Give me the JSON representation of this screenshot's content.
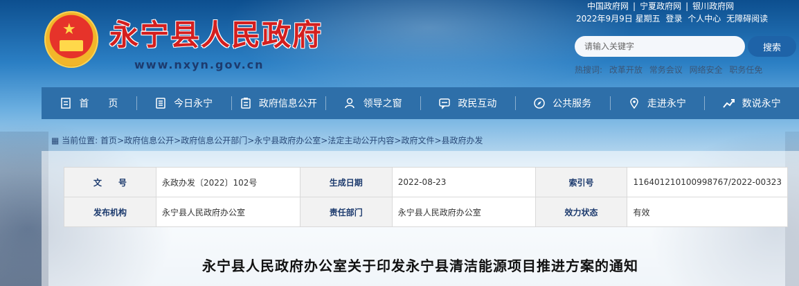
{
  "header": {
    "site_title": "永宁县人民政府",
    "site_url": "www.nxyn.gov.cn",
    "top_links": [
      "中国政府网",
      "宁夏政府网",
      "银川政府网"
    ],
    "date": "2022年9月9日 星期五",
    "quick_links": [
      "登录",
      "个人中心",
      "无障碍阅读"
    ]
  },
  "search": {
    "placeholder": "请输入关键字",
    "button": "搜索",
    "hot_label": "热搜词:",
    "hot_words": [
      "改革开放",
      "常务会议",
      "网络安全",
      "职务任免"
    ]
  },
  "nav": {
    "items": [
      {
        "label": "首　　页",
        "icon": "home-icon"
      },
      {
        "label": "今日永宁",
        "icon": "list-icon"
      },
      {
        "label": "政府信息公开",
        "icon": "document-icon"
      },
      {
        "label": "领导之窗",
        "icon": "user-icon"
      },
      {
        "label": "政民互动",
        "icon": "chat-icon"
      },
      {
        "label": "公共服务",
        "icon": "compass-icon"
      },
      {
        "label": "走进永宁",
        "icon": "location-icon"
      },
      {
        "label": "数说永宁",
        "icon": "trend-icon"
      }
    ]
  },
  "breadcrumb": {
    "label": "当前位置:",
    "items": [
      "首页",
      "政府信息公开",
      "政府信息公开部门",
      "永宁县政府办公室",
      "法定主动公开内容",
      "政府文件",
      "县政府办发"
    ]
  },
  "meta": {
    "rows": [
      [
        {
          "k": "文　　号",
          "v": "永政办发〔2022〕102号"
        },
        {
          "k": "生成日期",
          "v": "2022-08-23"
        },
        {
          "k": "索引号",
          "v": "116401210100998767/2022-00323"
        }
      ],
      [
        {
          "k": "发布机构",
          "v": "永宁县人民政府办公室"
        },
        {
          "k": "责任部门",
          "v": "永宁县人民政府办公室"
        },
        {
          "k": "效力状态",
          "v": "有效"
        }
      ]
    ]
  },
  "document": {
    "title": "永宁县人民政府办公室关于印发永宁县清洁能源项目推进方案的通知"
  }
}
